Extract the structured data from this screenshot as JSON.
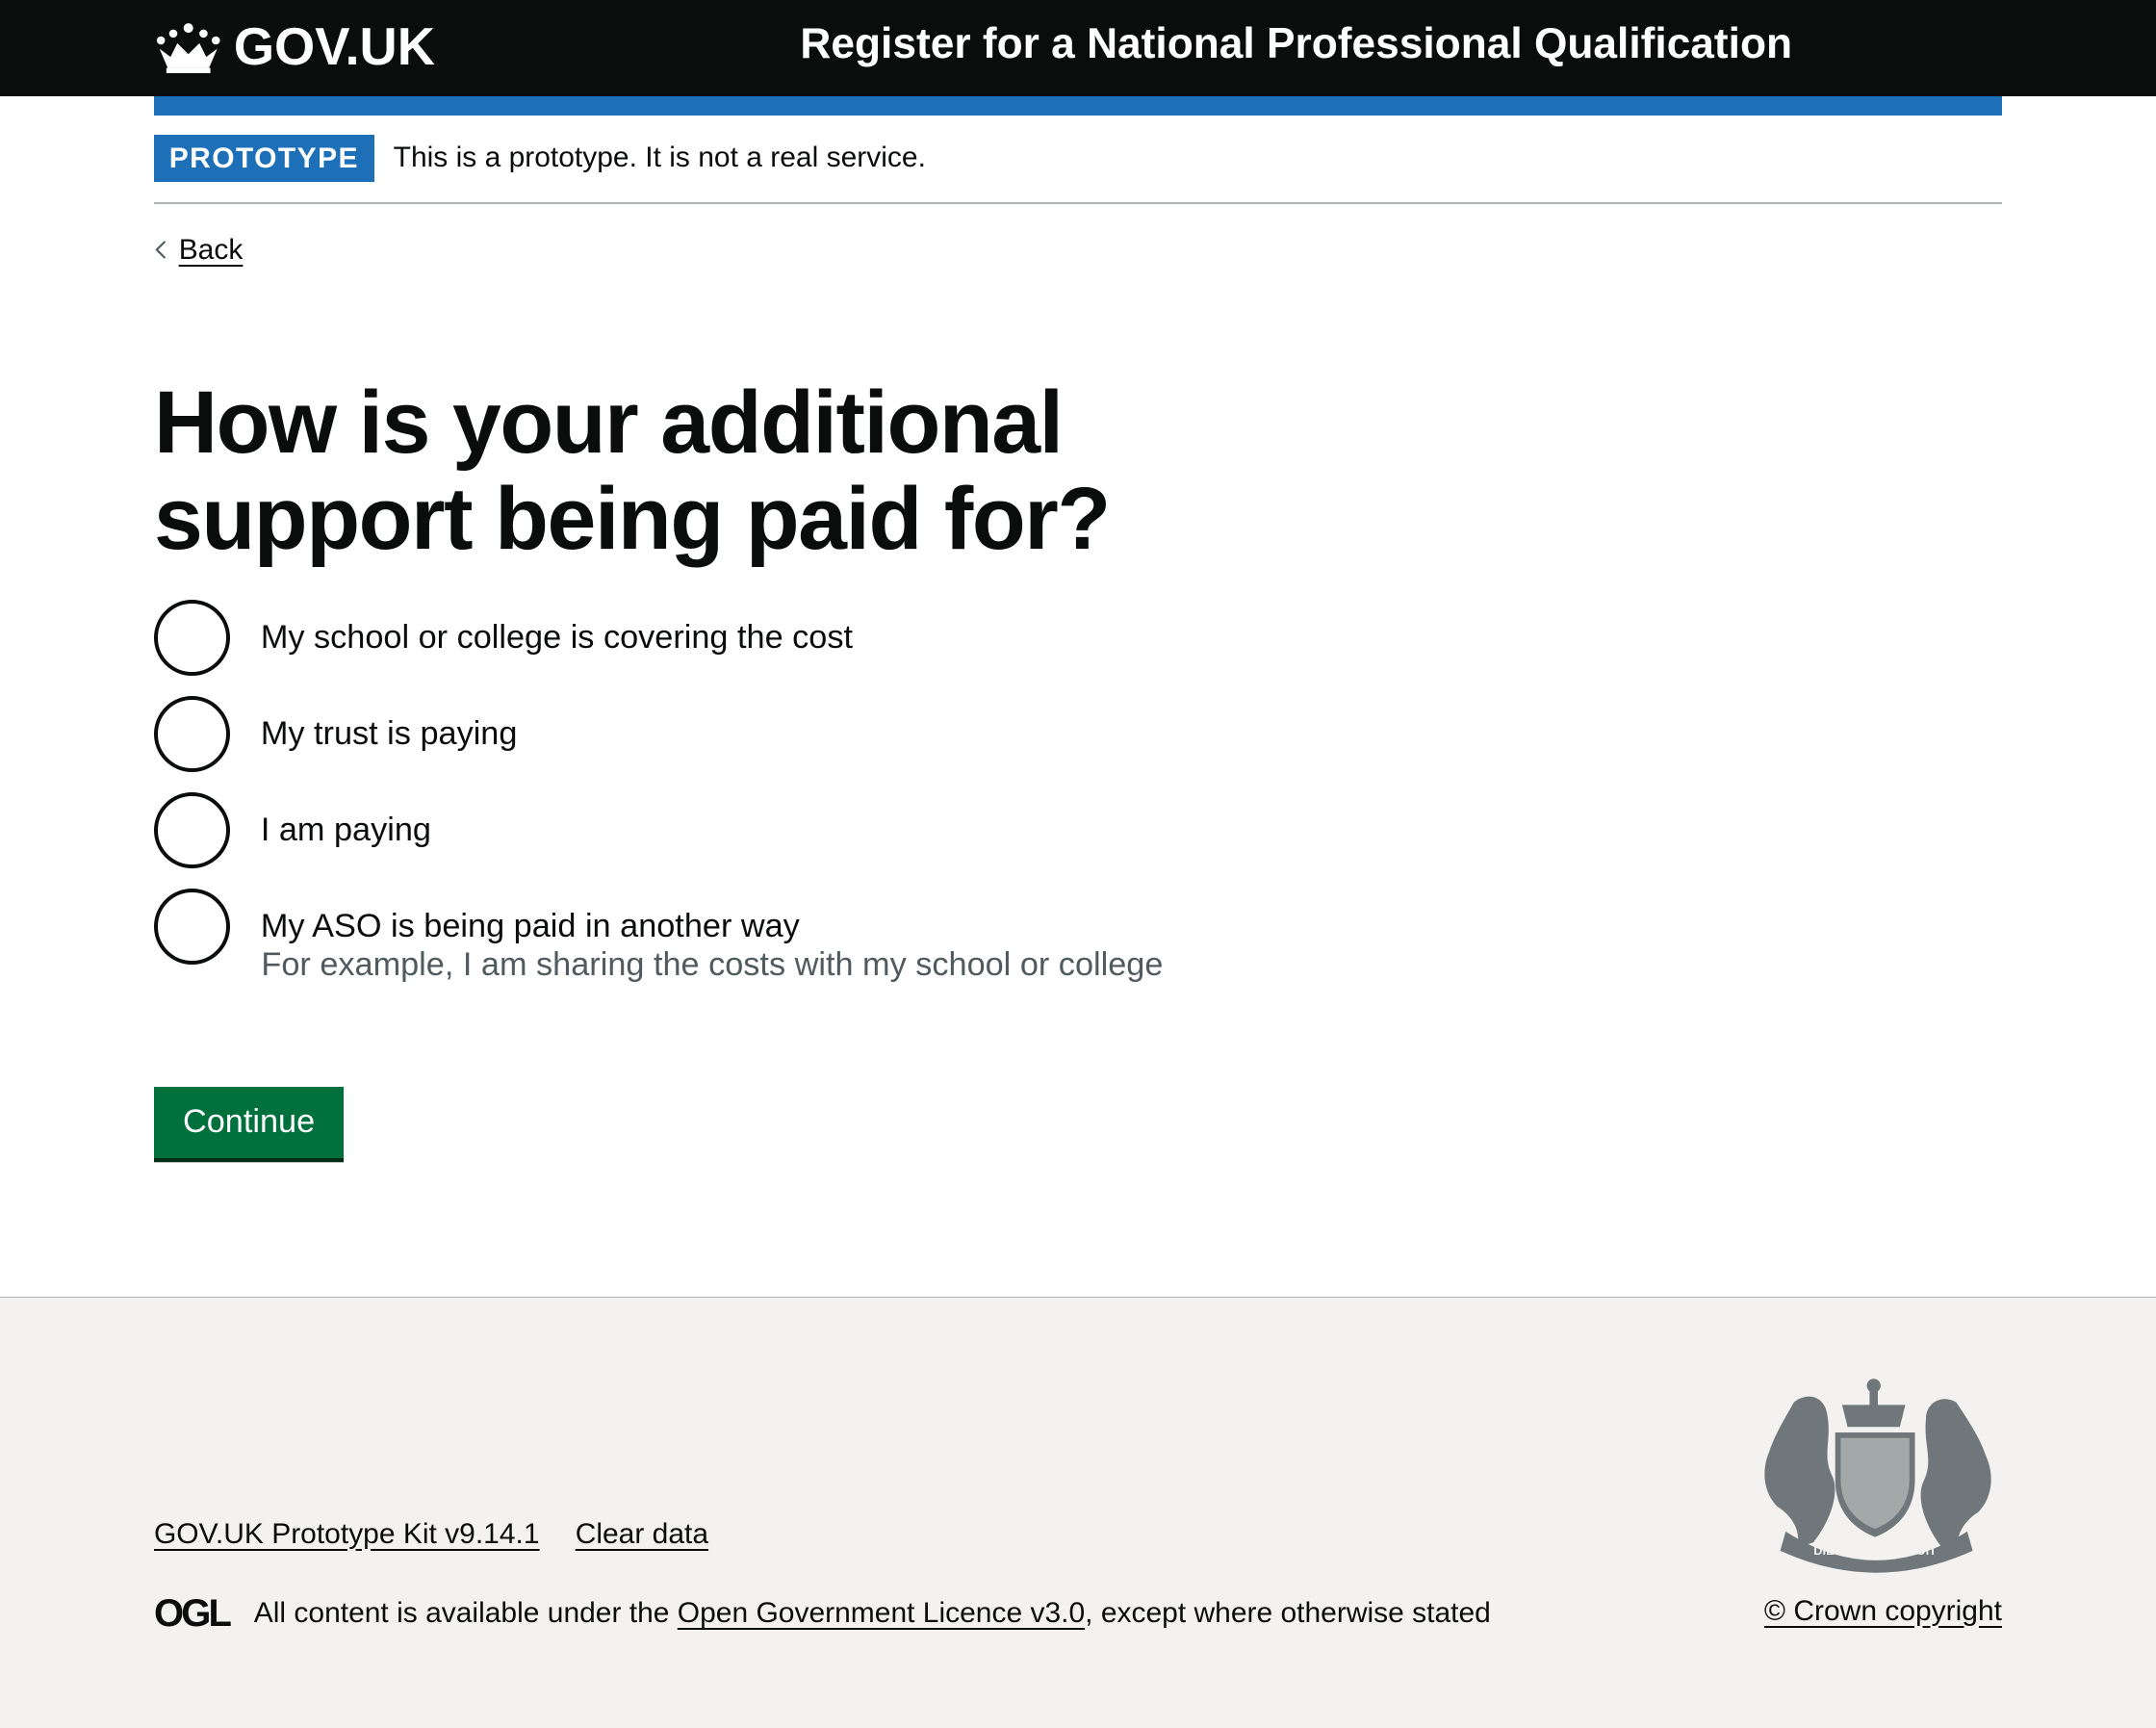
{
  "header": {
    "logo_text": "GOV.UK",
    "service_name": "Register for a National Professional Qualification"
  },
  "phase_banner": {
    "tag": "PROTOTYPE",
    "text": "This is a prototype. It is not a real service."
  },
  "back_link": "Back",
  "question": {
    "title": "How is your additional support being paid for?",
    "options": [
      {
        "label": "My school or college is covering the cost",
        "checked": false
      },
      {
        "label": "My trust is paying",
        "checked": false
      },
      {
        "label": "I am paying",
        "checked": false
      },
      {
        "label": "My ASO is being paid in another way",
        "hint": "For example, I am sharing the costs with my school or college",
        "checked": false
      }
    ]
  },
  "continue_label": "Continue",
  "footer": {
    "links": [
      "GOV.UK Prototype Kit v9.14.1",
      "Clear data"
    ],
    "ogl_logo": "OGL",
    "licence_prefix": "All content is available under the ",
    "licence_link": "Open Government Licence v3.0",
    "licence_suffix": ", except where otherwise stated",
    "copyright": "© Crown copyright",
    "crest_text": "DIEU ET MON DROIT"
  },
  "colors": {
    "header": "#0b0c0c",
    "brand_blue": "#1d70b8",
    "button_green": "#00703c",
    "footer_bg": "#f3f2f1",
    "hint": "#505a5f"
  }
}
